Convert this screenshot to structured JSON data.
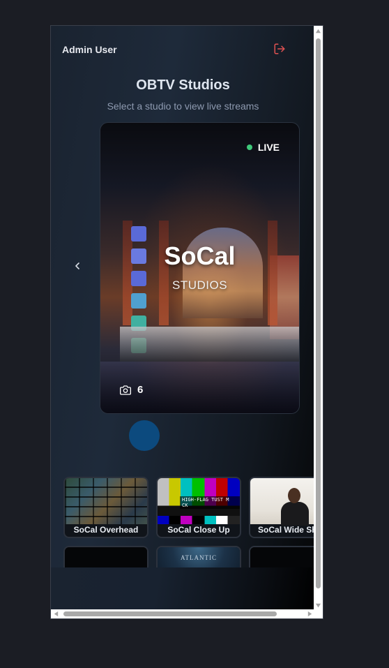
{
  "header": {
    "user_name": "Admin User",
    "logout_icon": "logout-icon",
    "logout_color": "#e05252"
  },
  "page": {
    "title": "OBTV Studios",
    "subtitle": "Select a studio to view live streams"
  },
  "featured_studio": {
    "name": "SoCal",
    "sub": "STUDIOS",
    "status": "LIVE",
    "status_color": "#3fc97a",
    "camera_count": "6",
    "camera_icon": "camera-icon"
  },
  "carousel": {
    "prev_icon": "chevron-left-icon",
    "indicator_color": "#0c4a7e"
  },
  "streams": [
    {
      "label": "SoCal Overhead"
    },
    {
      "label": "SoCal Close Up"
    },
    {
      "label": "SoCal Wide Shot"
    },
    {
      "label": ""
    },
    {
      "label": ""
    },
    {
      "label": ""
    }
  ],
  "test_pattern_text": "HIGH-FLAG TUST M CK",
  "atlantic_text": "ATLANTIC"
}
